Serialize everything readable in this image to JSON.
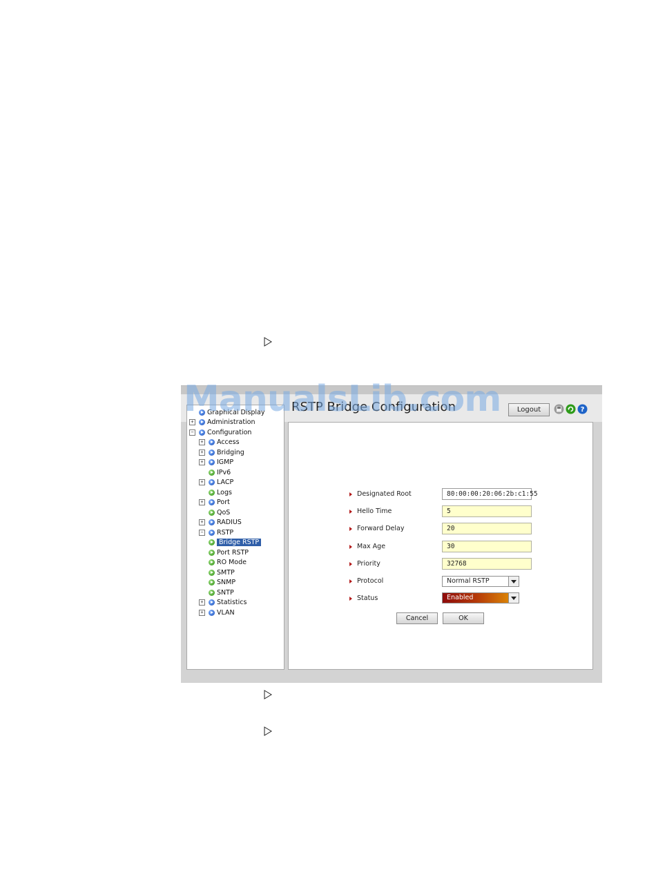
{
  "watermark": "ManualsLib.com",
  "page_title": "RSTP Bridge Configuration",
  "header": {
    "logout_label": "Logout",
    "icons": [
      "save-icon",
      "refresh-icon",
      "help-icon"
    ]
  },
  "nav": {
    "items": [
      {
        "label": "Graphical Display",
        "expander": "",
        "icon": "blue",
        "level": 0
      },
      {
        "label": "Administration",
        "expander": "+",
        "icon": "blue",
        "level": 0
      },
      {
        "label": "Configuration",
        "expander": "−",
        "icon": "blue",
        "level": 0
      },
      {
        "label": "Access",
        "expander": "+",
        "icon": "blue",
        "level": 1
      },
      {
        "label": "Bridging",
        "expander": "+",
        "icon": "blue",
        "level": 1
      },
      {
        "label": "IGMP",
        "expander": "+",
        "icon": "blue",
        "level": 1
      },
      {
        "label": "IPv6",
        "expander": "",
        "icon": "green",
        "level": 1
      },
      {
        "label": "LACP",
        "expander": "+",
        "icon": "blue",
        "level": 1
      },
      {
        "label": "Logs",
        "expander": "",
        "icon": "green",
        "level": 1
      },
      {
        "label": "Port",
        "expander": "+",
        "icon": "blue",
        "level": 1
      },
      {
        "label": "QoS",
        "expander": "",
        "icon": "green",
        "level": 1
      },
      {
        "label": "RADIUS",
        "expander": "+",
        "icon": "blue",
        "level": 1
      },
      {
        "label": "RSTP",
        "expander": "−",
        "icon": "blue",
        "level": 1
      },
      {
        "label": "Bridge RSTP",
        "expander": "",
        "icon": "green",
        "level": 2,
        "selected": true
      },
      {
        "label": "Port RSTP",
        "expander": "",
        "icon": "green",
        "level": 2
      },
      {
        "label": "RO Mode",
        "expander": "",
        "icon": "green",
        "level": 2
      },
      {
        "label": "SMTP",
        "expander": "",
        "icon": "green",
        "level": 1
      },
      {
        "label": "SNMP",
        "expander": "",
        "icon": "green",
        "level": 1
      },
      {
        "label": "SNTP",
        "expander": "",
        "icon": "green",
        "level": 1
      },
      {
        "label": "Statistics",
        "expander": "+",
        "icon": "blue",
        "level": 1
      },
      {
        "label": "VLAN",
        "expander": "+",
        "icon": "blue",
        "level": 1
      }
    ]
  },
  "form": {
    "designated_root": {
      "label": "Designated Root",
      "value": "80:00:00:20:06:2b:c1:55"
    },
    "hello_time": {
      "label": "Hello Time",
      "value": "5"
    },
    "forward_delay": {
      "label": "Forward Delay",
      "value": "20"
    },
    "max_age": {
      "label": "Max Age",
      "value": "30"
    },
    "priority": {
      "label": "Priority",
      "value": "32768"
    },
    "protocol": {
      "label": "Protocol",
      "value": "Normal RSTP"
    },
    "status": {
      "label": "Status",
      "value": "Enabled"
    }
  },
  "buttons": {
    "cancel": "Cancel",
    "ok": "OK"
  },
  "colors": {
    "status_gradient_start": "#8e0b0b",
    "status_gradient_end": "#e69a06",
    "selection": "#2f5ea8",
    "field_bg": "#ffffcc"
  }
}
